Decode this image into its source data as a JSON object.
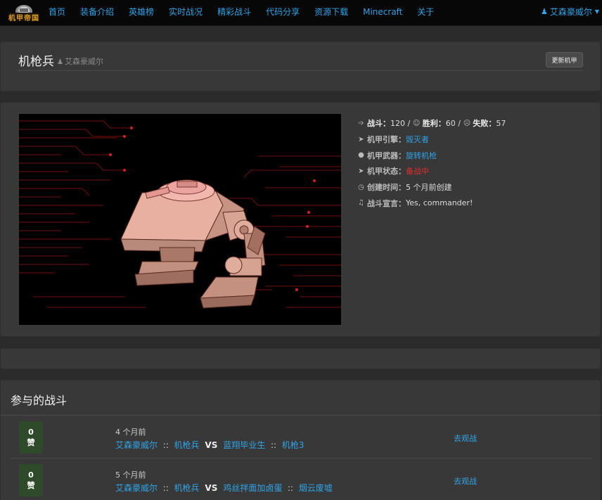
{
  "nav": {
    "logo_text": "机甲帝国",
    "items": [
      "首页",
      "装备介绍",
      "英雄榜",
      "实时战况",
      "精彩战斗",
      "代码分享",
      "资源下载",
      "Minecraft",
      "关于"
    ],
    "user": "艾森豪威尔"
  },
  "header": {
    "title": "机枪兵",
    "owner": "艾森豪威尔",
    "update_button": "更新机甲"
  },
  "stats": {
    "battle_label": "战斗：",
    "battles": "120",
    "win_label": "胜利：",
    "wins": "60",
    "loss_label": "失败：",
    "losses": "57",
    "engine_label": "机甲引擎：",
    "engine": "毁灭者",
    "weapon_label": "机甲武器：",
    "weapon": "旋转机枪",
    "status_label": "机甲状态：",
    "status": "备战中",
    "created_label": "创建时间：",
    "created": "5 个月前创建",
    "motto_label": "战斗宣言：",
    "motto": "Yes, commander!"
  },
  "battles": {
    "title": "参与的战斗",
    "vote_unit": "赞",
    "watch_label": "去观战",
    "rows": [
      {
        "votes": "0",
        "time": "4 个月前",
        "p1": "艾森豪威尔",
        "m1": "机枪兵",
        "vs": "VS",
        "p2": "蓝翔毕业生",
        "m2": "机枪3",
        "sep": "::"
      },
      {
        "votes": "0",
        "time": "5 个月前",
        "p1": "艾森豪威尔",
        "m1": "机枪兵",
        "vs": "VS",
        "p2": "鸡丝拌面加卤蛋",
        "m2": "烟云废墟",
        "sep": "::"
      }
    ]
  },
  "colors": {
    "link": "#2fa4e7",
    "status_red": "#e32b2b",
    "vote_bg": "#2f4a2a"
  }
}
